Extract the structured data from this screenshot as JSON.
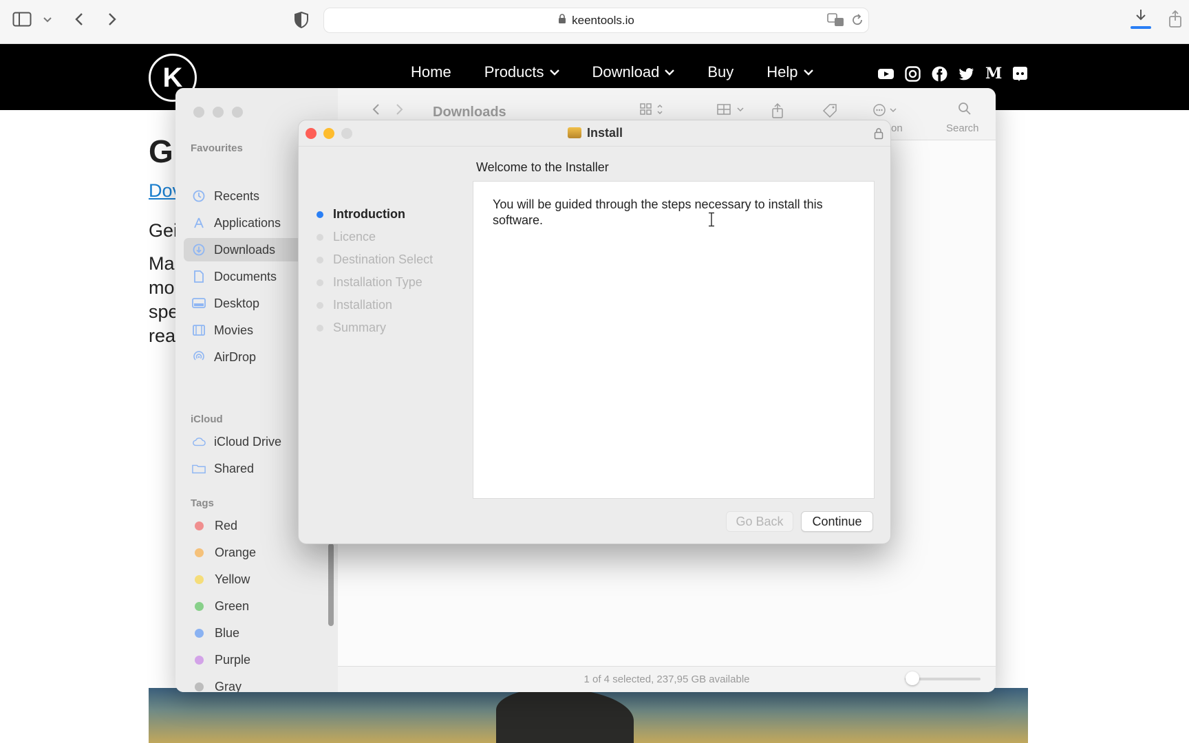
{
  "browser": {
    "url": "keentools.io",
    "accent": "#2a7ff5"
  },
  "site": {
    "logo_letter": "K",
    "nav": [
      {
        "label": "Home"
      },
      {
        "label": "Products"
      },
      {
        "label": "Download"
      },
      {
        "label": "Buy"
      },
      {
        "label": "Help"
      }
    ],
    "social_icons": [
      "youtube-icon",
      "instagram-icon",
      "facebook-icon",
      "twitter-icon",
      "medium-icon",
      "discord-icon"
    ],
    "medium_letter": "M",
    "partial_text": {
      "heading": "G",
      "link": "Dov",
      "line1": "Gei",
      "line2": "Ma",
      "line3": "mo",
      "line4": "spe",
      "line5": "rea"
    }
  },
  "finder": {
    "title": "Downloads",
    "favourites_label": "Favourites",
    "favourites": [
      {
        "label": "Recents",
        "icon": "clock-icon"
      },
      {
        "label": "Applications",
        "icon": "applications-icon"
      },
      {
        "label": "Downloads",
        "icon": "download-icon"
      },
      {
        "label": "Documents",
        "icon": "document-icon"
      },
      {
        "label": "Desktop",
        "icon": "desktop-icon"
      },
      {
        "label": "Movies",
        "icon": "film-icon"
      },
      {
        "label": "AirDrop",
        "icon": "airdrop-icon"
      }
    ],
    "icloud_label": "iCloud",
    "icloud": [
      {
        "label": "iCloud Drive",
        "icon": "cloud-icon"
      },
      {
        "label": "Shared",
        "icon": "shared-folder-icon"
      }
    ],
    "tags_label": "Tags",
    "tags": [
      {
        "label": "Red",
        "color": "#f08f8f"
      },
      {
        "label": "Orange",
        "color": "#f5c17a"
      },
      {
        "label": "Yellow",
        "color": "#f5dd7a"
      },
      {
        "label": "Green",
        "color": "#88d08a"
      },
      {
        "label": "Blue",
        "color": "#8ab2f2"
      },
      {
        "label": "Purple",
        "color": "#d3a3e8"
      },
      {
        "label": "Gray",
        "color": "#bdbdbd"
      }
    ],
    "search_label": "Search",
    "partial_label": "on",
    "status": "1 of 4 selected, 237,95 GB available"
  },
  "installer": {
    "title": "Install",
    "heading": "Welcome to the  Installer",
    "steps": [
      {
        "label": "Introduction",
        "active": true
      },
      {
        "label": "Licence",
        "active": false
      },
      {
        "label": "Destination Select",
        "active": false
      },
      {
        "label": "Installation Type",
        "active": false
      },
      {
        "label": "Installation",
        "active": false
      },
      {
        "label": "Summary",
        "active": false
      }
    ],
    "body": "You will be guided through the steps necessary to install this software.",
    "go_back_label": "Go Back",
    "continue_label": "Continue",
    "traffic_colors": [
      "#fe5f57",
      "#febc2e",
      "#d9d9d9"
    ]
  }
}
